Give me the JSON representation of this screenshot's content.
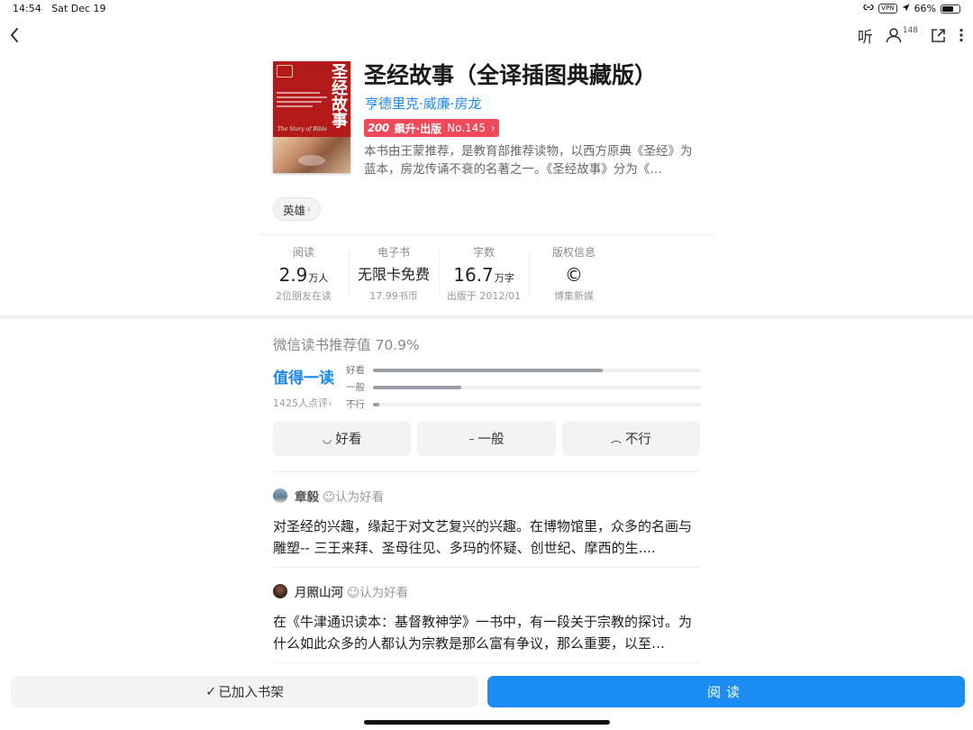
{
  "status": {
    "time": "14:54",
    "date": "Sat Dec 19",
    "vpn": "VPN",
    "battery": "66%",
    "battery_level": 0.66
  },
  "nav": {
    "listen_label": "听",
    "followers_count": "148"
  },
  "book": {
    "title": "圣经故事（全译插图典藏版）",
    "author": "亨德里克·威廉·房龙",
    "cover_title": "圣经故事",
    "cover_subtitle": "The Story of Bible",
    "rank_brand": "200",
    "rank_label": "飙升·出版",
    "rank_number": "No.145",
    "description": "本书由王蒙推荐，是教育部推荐读物，以西方原典《圣经》为蓝本，房龙传诵不衰的名著之一。《圣经故事》分为《…",
    "tag": "英雄"
  },
  "stats": [
    {
      "label": "阅读",
      "value": "2.9",
      "unit": "万人",
      "sub": "2位朋友在读"
    },
    {
      "label": "电子书",
      "value": "无限卡免费",
      "unit": "",
      "sub": "17.99书币"
    },
    {
      "label": "字数",
      "value": "16.7",
      "unit": "万字",
      "sub": "出版于 2012/01"
    },
    {
      "label": "版权信息",
      "value": "©",
      "unit": "",
      "sub": "博集新媒"
    }
  ],
  "recommend": {
    "title": "微信读书推荐值",
    "score": "70.9%",
    "verdict": "值得一读",
    "review_count": "1425人点评",
    "bars": [
      {
        "label": "好看",
        "value": 0.7
      },
      {
        "label": "一般",
        "value": 0.27
      },
      {
        "label": "不行",
        "value": 0.02
      }
    ],
    "votes": [
      {
        "face": "◡",
        "label": "好看"
      },
      {
        "face": "–",
        "label": "一般"
      },
      {
        "face": "︵",
        "label": "不行"
      }
    ]
  },
  "reviews": [
    {
      "user": "章毅",
      "opinion": "☺认为好看",
      "text": "对圣经的兴趣，缘起于对文艺复兴的兴趣。在博物馆里，众多的名画与雕塑-- 三王来拜、圣母往见、多玛的怀疑、创世纪、摩西的生...."
    },
    {
      "user": "月照山河",
      "opinion": "☺认为好看",
      "text": "在《牛津通识读本：基督教神学》一书中，有一段关于宗教的探讨。为什么如此众多的人都认为宗教是那么富有争议，那么重要，以至…"
    }
  ],
  "bottom": {
    "shelf_label": "已加入书架",
    "read_label": "阅读"
  }
}
